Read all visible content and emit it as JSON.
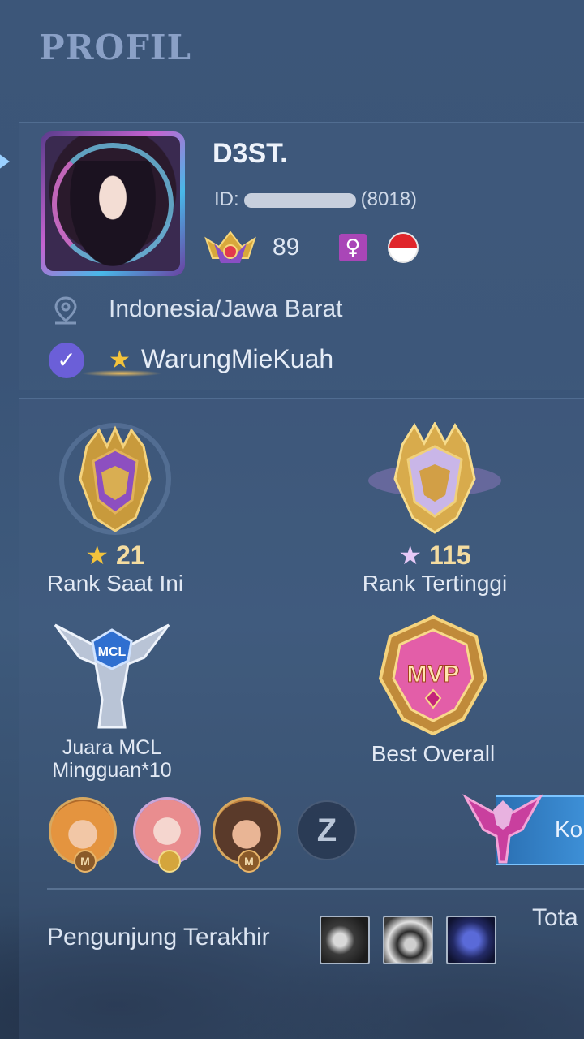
{
  "header": {
    "title": "PROFIL"
  },
  "profile": {
    "name": "D3ST.",
    "id_prefix": "ID:",
    "id_server": "(8018)",
    "level": "89",
    "gender_icon": "female-icon",
    "flag_icon": "indonesia-flag-icon",
    "location": "Indonesia/Jawa Barat",
    "squad": "WarungMieKuah"
  },
  "stats": {
    "current_rank": {
      "stars": "21",
      "label": "Rank Saat Ini"
    },
    "highest_rank": {
      "stars": "115",
      "label": "Rank Tertinggi"
    },
    "mcl": {
      "label_line1": "Juara MCL",
      "label_line2": "Mingguan*10"
    },
    "best_overall": {
      "label": "Best Overall",
      "badge_text": "MVP"
    }
  },
  "emblem": {
    "text": "MCL"
  },
  "heroes": [
    {
      "badge": "M"
    },
    {
      "badge": ""
    },
    {
      "badge": "M"
    }
  ],
  "switch": {
    "symbol": "Z"
  },
  "side_banner": {
    "text": "Ko"
  },
  "visitors": {
    "label": "Pengunjung Terakhir",
    "total_label": "Tota"
  },
  "colors": {
    "accent_gold": "#f4dca0",
    "female_purple": "#a946b7",
    "title": "#8aa0c6"
  }
}
